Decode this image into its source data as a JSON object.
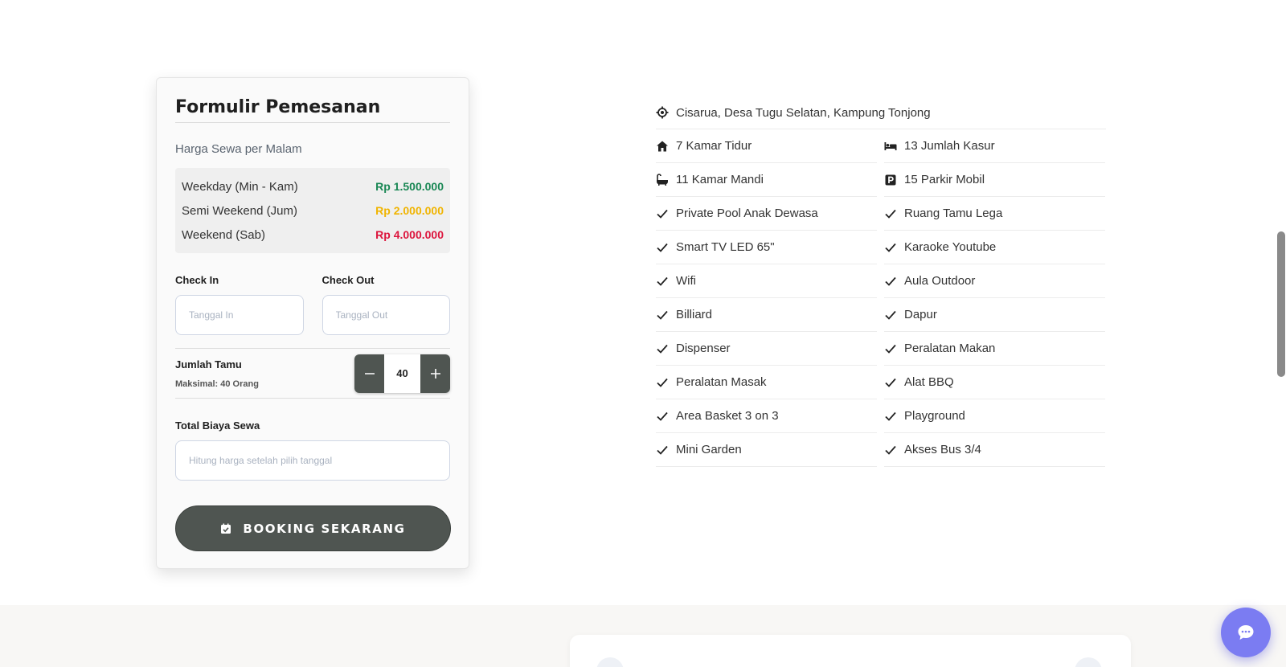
{
  "booking": {
    "title": "Formulir Pemesanan",
    "price_heading": "Harga Sewa per Malam",
    "prices": [
      {
        "label": "Weekday (Min - Kam)",
        "value": "Rp 1.500.000",
        "color": "#198754"
      },
      {
        "label": "Semi Weekend (Jum)",
        "value": "Rp 2.000.000",
        "color": "#f0b400"
      },
      {
        "label": "Weekend (Sab)",
        "value": "Rp 4.000.000",
        "color": "#dc143c"
      }
    ],
    "check_in_label": "Check In",
    "check_in_placeholder": "Tanggal In",
    "check_out_label": "Check Out",
    "check_out_placeholder": "Tanggal Out",
    "guests_label": "Jumlah Tamu",
    "guests_max": "Maksimal: 40 Orang",
    "guests_value": "40",
    "total_label": "Total Biaya Sewa",
    "total_placeholder": "Hitung harga setelah pilih tanggal",
    "book_button": "BOOKING SEKARANG",
    "button_color": "#4f5551"
  },
  "facilities": {
    "location": "Cisarua, Desa Tugu Selatan, Kampung Tonjong",
    "items": [
      {
        "icon": "house-icon",
        "label": "7 Kamar Tidur"
      },
      {
        "icon": "bed-icon",
        "label": "13 Jumlah Kasur"
      },
      {
        "icon": "bathtub-icon",
        "label": "11 Kamar Mandi"
      },
      {
        "icon": "parking-icon",
        "label": "15 Parkir Mobil"
      },
      {
        "icon": "check-icon",
        "label": "Private Pool Anak Dewasa"
      },
      {
        "icon": "check-icon",
        "label": "Ruang Tamu Lega"
      },
      {
        "icon": "check-icon",
        "label": "Smart TV LED 65\""
      },
      {
        "icon": "check-icon",
        "label": "Karaoke Youtube"
      },
      {
        "icon": "check-icon",
        "label": "Wifi"
      },
      {
        "icon": "check-icon",
        "label": "Aula Outdoor"
      },
      {
        "icon": "check-icon",
        "label": "Billiard"
      },
      {
        "icon": "check-icon",
        "label": "Dapur"
      },
      {
        "icon": "check-icon",
        "label": "Dispenser"
      },
      {
        "icon": "check-icon",
        "label": "Peralatan Makan"
      },
      {
        "icon": "check-icon",
        "label": "Peralatan Masak"
      },
      {
        "icon": "check-icon",
        "label": "Alat BBQ"
      },
      {
        "icon": "check-icon",
        "label": "Area Basket 3 on 3"
      },
      {
        "icon": "check-icon",
        "label": "Playground"
      },
      {
        "icon": "check-icon",
        "label": "Mini Garden"
      },
      {
        "icon": "check-icon",
        "label": "Akses Bus 3/4"
      }
    ]
  },
  "chat": {
    "icon": "chat-icon",
    "color": "#7b7cf2"
  }
}
